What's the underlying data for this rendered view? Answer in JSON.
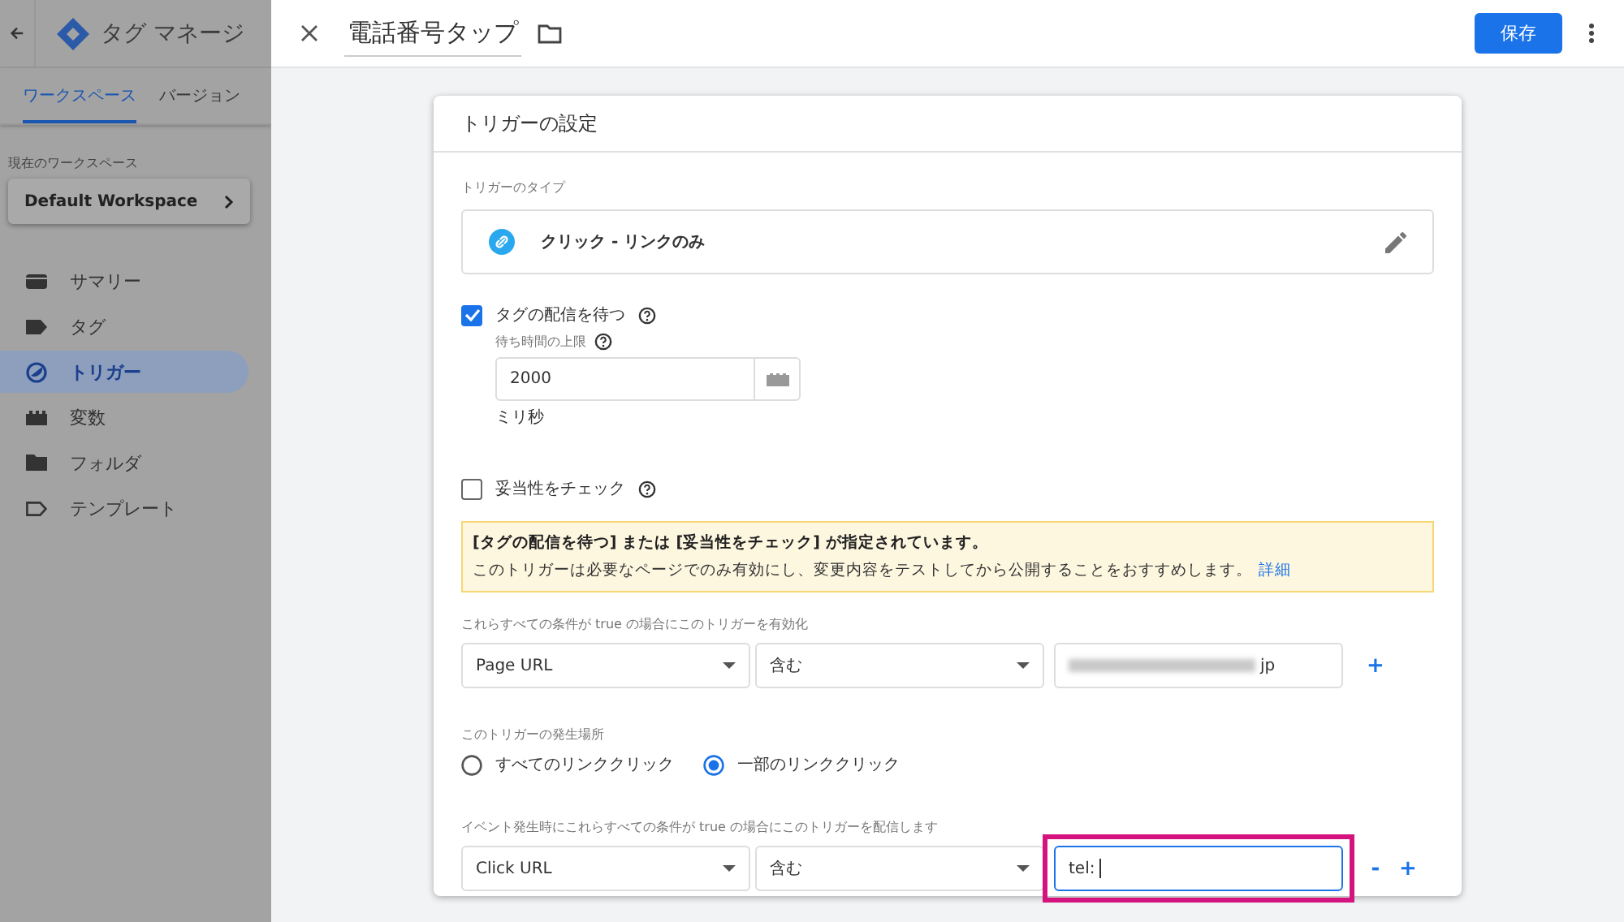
{
  "sidebar": {
    "app_title": "タグ マネージ",
    "tabs": [
      {
        "label": "ワークスペース",
        "selected": true
      },
      {
        "label": "バージョン",
        "selected": false
      }
    ],
    "workspace_label": "現在のワークスペース",
    "workspace": "Default Workspace",
    "items": [
      {
        "label": "サマリー",
        "selected": false
      },
      {
        "label": "タグ",
        "selected": false
      },
      {
        "label": "トリガー",
        "selected": true
      },
      {
        "label": "変数",
        "selected": false
      },
      {
        "label": "フォルダ",
        "selected": false
      },
      {
        "label": "テンプレート",
        "selected": false
      }
    ]
  },
  "header": {
    "title": "電話番号タップ",
    "save": "保存"
  },
  "card": {
    "title": "トリガーの設定",
    "type_label": "トリガーのタイプ",
    "type": "クリック - リンクのみ",
    "wait": {
      "label": "タグの配信を待つ",
      "checked": true,
      "limit_label": "待ち時間の上限",
      "value": "2000",
      "unit": "ミリ秒"
    },
    "validate": {
      "label": "妥当性をチェック",
      "checked": false
    },
    "notice": {
      "title": "[タグの配信を待つ] または [妥当性をチェック] が指定されています。",
      "text": "このトリガーは必要なページでのみ有効にし、変更内容をテストしてから公開することをおすすめします。",
      "link": "詳細"
    },
    "enable_label": "これらすべての条件が true の場合にこのトリガーを有効化",
    "enable_filters": [
      {
        "variable": "Page URL",
        "operator": "含む",
        "value": "jp",
        "redacted": true,
        "focused": false,
        "highlighted": false,
        "actions": [
          "+"
        ]
      }
    ],
    "scope_label": "このトリガーの発生場所",
    "scope": [
      {
        "label": "すべてのリンククリック",
        "selected": false
      },
      {
        "label": "一部のリンククリック",
        "selected": true
      }
    ],
    "fire_label": "イベント発生時にこれらすべての条件が true の場合にこのトリガーを配信します",
    "fire_filters": [
      {
        "variable": "Click URL",
        "operator": "含む",
        "value": "tel:",
        "focused": true,
        "highlighted": true,
        "actions": [
          "-",
          "+"
        ]
      }
    ]
  }
}
